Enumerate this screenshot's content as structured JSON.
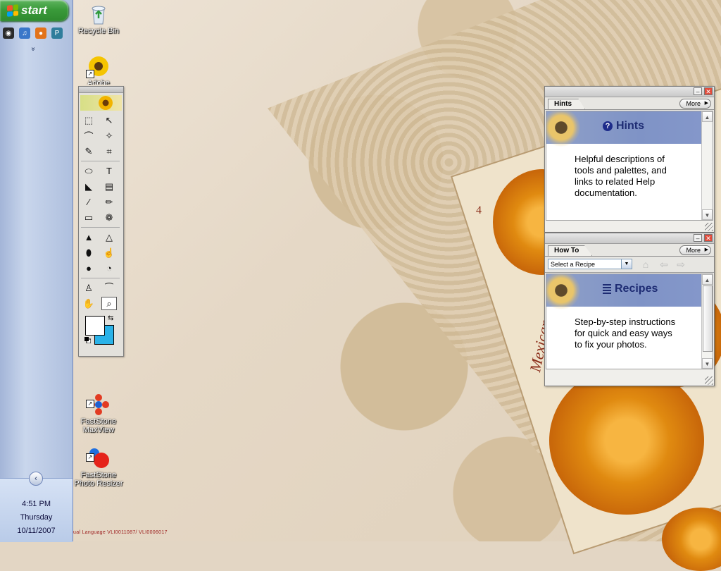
{
  "taskbar": {
    "start_label": "start",
    "quick_launch": [
      {
        "name": "media-icon",
        "glyph": "◉",
        "color": "#2b2b2b"
      },
      {
        "name": "itunes-icon",
        "glyph": "♫",
        "color": "#3a77c9"
      },
      {
        "name": "firefox-icon",
        "glyph": "●",
        "color": "#e2731b"
      },
      {
        "name": "publisher-icon",
        "glyph": "P",
        "color": "#2f7d9c"
      }
    ],
    "more_glyph": "»",
    "collapse_glyph": "‹",
    "clock": {
      "time": "4:51 PM",
      "day": "Thursday",
      "date": "10/11/2007"
    }
  },
  "desktop": {
    "icons": [
      {
        "name": "recycle-bin",
        "label": "Recycle Bin"
      },
      {
        "name": "adobe",
        "label": "Adobe"
      },
      {
        "name": "faststone-maxview",
        "label": "FastStone\nMaxView"
      },
      {
        "name": "faststone-photo-resizer",
        "label": "FastStone\nPhoto Resizer"
      }
    ],
    "watermark": "ual Language VLI0011087/ VLI0006017",
    "card_text": "Mexican us",
    "card_number": "4"
  },
  "toolbox": {
    "tools": [
      {
        "name": "marquee-tool",
        "glyph": "⬚"
      },
      {
        "name": "move-tool",
        "glyph": "↖"
      },
      {
        "name": "lasso-tool",
        "glyph": "⌒"
      },
      {
        "name": "magic-wand-tool",
        "glyph": "✧"
      },
      {
        "name": "selection-brush-tool",
        "glyph": "✎"
      },
      {
        "name": "crop-tool",
        "glyph": "⌗"
      },
      {
        "name": "sep"
      },
      {
        "name": "shape-tool",
        "glyph": "⬭"
      },
      {
        "name": "type-tool",
        "glyph": "T"
      },
      {
        "name": "paint-bucket-tool",
        "glyph": "◣"
      },
      {
        "name": "gradient-tool",
        "glyph": "▤"
      },
      {
        "name": "brush-tool",
        "glyph": "⁄"
      },
      {
        "name": "pencil-tool",
        "glyph": "✏"
      },
      {
        "name": "eraser-tool",
        "glyph": "▭"
      },
      {
        "name": "red-eye-tool",
        "glyph": "❁"
      },
      {
        "name": "sep"
      },
      {
        "name": "blur-tool",
        "glyph": "▲"
      },
      {
        "name": "sharpen-tool",
        "glyph": "△"
      },
      {
        "name": "sponge-tool",
        "glyph": "⬮"
      },
      {
        "name": "smudge-tool",
        "glyph": "☝"
      },
      {
        "name": "dodge-tool",
        "glyph": "●"
      },
      {
        "name": "burn-tool",
        "glyph": "◔"
      },
      {
        "name": "sep"
      },
      {
        "name": "clone-stamp-tool",
        "glyph": "♙"
      },
      {
        "name": "eyedropper-tool",
        "glyph": "⁀"
      },
      {
        "name": "hand-tool",
        "glyph": "✋"
      },
      {
        "name": "zoom-tool",
        "glyph": "⌕",
        "active": true
      }
    ],
    "foreground_color": "#ffffff",
    "background_color": "#2ab2e8",
    "swap_glyph": "⇆"
  },
  "hints_palette": {
    "tab_label": "Hints",
    "more_label": "More",
    "heading": "Hints",
    "body": "Helpful descriptions of tools and palettes, and links to related Help documentation."
  },
  "howto_palette": {
    "tab_label": "How To",
    "more_label": "More",
    "select_value": "Select a Recipe",
    "heading": "Recipes",
    "body": "Step-by-step instructions for quick and easy ways to fix your photos."
  },
  "colors": {
    "banner_blue": "#8497ca",
    "heading_navy": "#1e2c73",
    "start_green": "#3a9a3a",
    "close_red": "#e04b3b"
  }
}
